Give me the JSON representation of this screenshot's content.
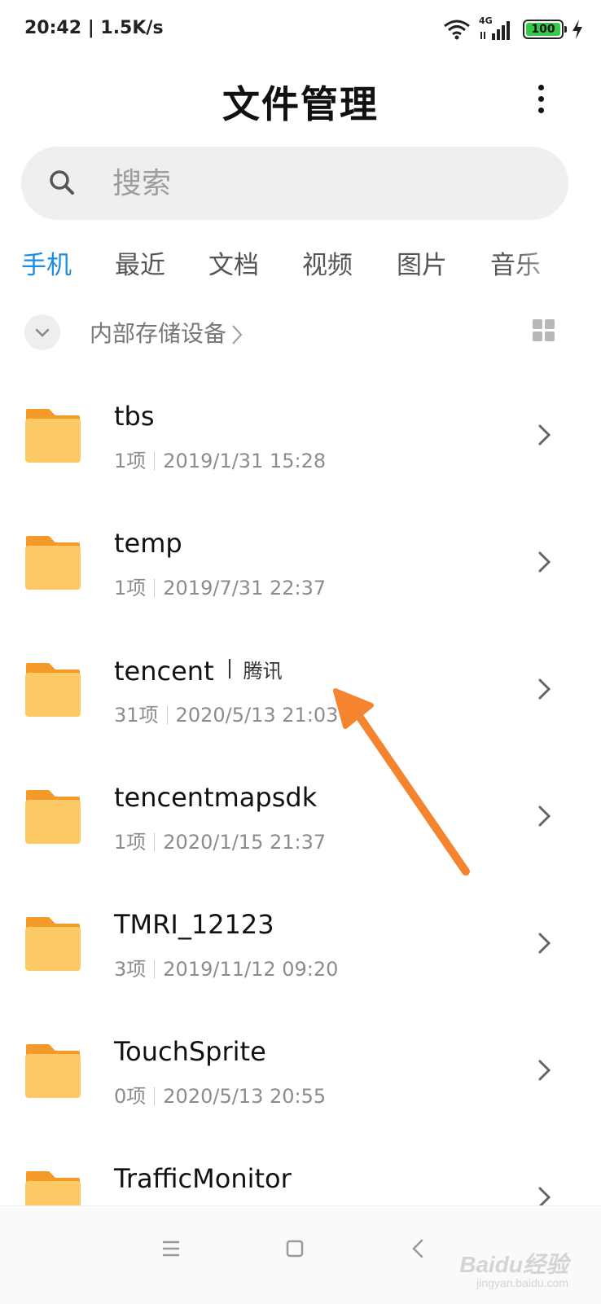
{
  "status_bar": {
    "time_speed": "20:42 | 1.5K/s",
    "network": "4G",
    "battery": "100"
  },
  "header": {
    "title": "文件管理"
  },
  "search": {
    "placeholder": "搜索"
  },
  "tabs": [
    {
      "label": "手机",
      "active": true
    },
    {
      "label": "最近",
      "active": false
    },
    {
      "label": "文档",
      "active": false
    },
    {
      "label": "视频",
      "active": false
    },
    {
      "label": "图片",
      "active": false
    },
    {
      "label": "音乐",
      "active": false
    }
  ],
  "path": {
    "label": "内部存储设备"
  },
  "files": [
    {
      "name": "tbs",
      "alias": "",
      "count": "1项",
      "date": "2019/1/31 15:28"
    },
    {
      "name": "temp",
      "alias": "",
      "count": "1项",
      "date": "2019/7/31 22:37"
    },
    {
      "name": "tencent",
      "alias": "腾讯",
      "count": "31项",
      "date": "2020/5/13 21:03"
    },
    {
      "name": "tencentmapsdk",
      "alias": "",
      "count": "1项",
      "date": "2020/1/15 21:37"
    },
    {
      "name": "TMRI_12123",
      "alias": "",
      "count": "3项",
      "date": "2019/11/12 09:20"
    },
    {
      "name": "TouchSprite",
      "alias": "",
      "count": "0项",
      "date": "2020/5/13 20:55"
    },
    {
      "name": "TrafficMonitor",
      "alias": "",
      "count": "",
      "date": ""
    }
  ],
  "watermark": {
    "text": "Baidu经验",
    "sub": "jingyan.baidu.com"
  },
  "colors": {
    "accent": "#1a8ee3",
    "folder": "#fcc964",
    "folder_tab": "#f49a28",
    "arrow": "#f5842f"
  }
}
